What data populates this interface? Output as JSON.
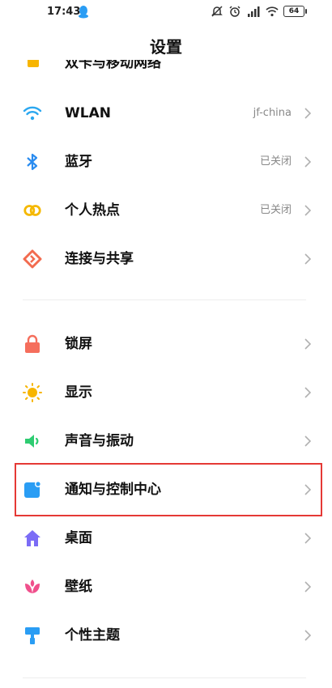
{
  "status_bar": {
    "time": "17:43",
    "battery": "64"
  },
  "header": {
    "title": "设置"
  },
  "cutoff_item": {
    "label": "双卡与移动网络"
  },
  "group1": [
    {
      "key": "wlan",
      "label": "WLAN",
      "value": "jf-china",
      "icon": "wifi-icon",
      "color": "#2aa7f0"
    },
    {
      "key": "bluetooth",
      "label": "蓝牙",
      "value": "已关闭",
      "icon": "bluetooth-icon",
      "color": "#2a8cf0"
    },
    {
      "key": "hotspot",
      "label": "个人热点",
      "value": "已关闭",
      "icon": "hotspot-icon",
      "color": "#f5b800"
    },
    {
      "key": "connect-share",
      "label": "连接与共享",
      "value": "",
      "icon": "connect-share-icon",
      "color": "#f26b4f"
    }
  ],
  "group2": [
    {
      "key": "lock-screen",
      "label": "锁屏",
      "value": "",
      "icon": "lock-icon",
      "color": "#f56e5c"
    },
    {
      "key": "display",
      "label": "显示",
      "value": "",
      "icon": "sun-icon",
      "color": "#f7b500"
    },
    {
      "key": "sound",
      "label": "声音与振动",
      "value": "",
      "icon": "speaker-icon",
      "color": "#2ecc71"
    },
    {
      "key": "notifications",
      "label": "通知与控制中心",
      "value": "",
      "icon": "notification-icon",
      "color": "#2a9df4"
    },
    {
      "key": "home-screen",
      "label": "桌面",
      "value": "",
      "icon": "home-icon",
      "color": "#7b6cf6"
    },
    {
      "key": "wallpaper",
      "label": "壁纸",
      "value": "",
      "icon": "flower-icon",
      "color": "#f0508c"
    },
    {
      "key": "themes",
      "label": "个性主题",
      "value": "",
      "icon": "paint-roller-icon",
      "color": "#2a9df4"
    }
  ]
}
